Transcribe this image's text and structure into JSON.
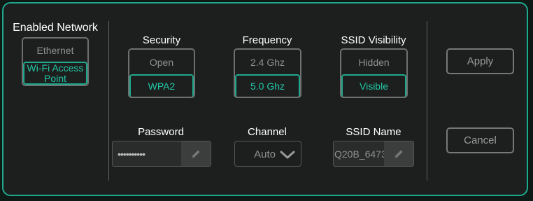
{
  "enabled_network": {
    "title": "Enabled Network",
    "ethernet": "Ethernet",
    "wifi_line1": "Wi-Fi Access",
    "wifi_line2": "Point",
    "selected": "wifi"
  },
  "security": {
    "label": "Security",
    "options": [
      "Open",
      "WPA2"
    ],
    "selected": "WPA2"
  },
  "frequency": {
    "label": "Frequency",
    "options": [
      "2.4 Ghz",
      "5.0 Ghz"
    ],
    "selected": "5.0 Ghz"
  },
  "ssid_visibility": {
    "label": "SSID Visibility",
    "options": [
      "Hidden",
      "Visible"
    ],
    "selected": "Visible"
  },
  "password": {
    "label": "Password",
    "value": "••••••••••"
  },
  "channel": {
    "label": "Channel",
    "value": "Auto"
  },
  "ssid_name": {
    "label": "SSID Name",
    "value": "Q20B_6473"
  },
  "actions": {
    "apply": "Apply",
    "cancel": "Cancel"
  },
  "colors": {
    "accent": "#1fa98c",
    "accent_text": "#22c7a4",
    "inactive": "#8f8f8f",
    "panel_bg": "#1d1f1f"
  },
  "icons": {
    "edit": "pencil-icon",
    "dropdown": "chevron-down-icon"
  }
}
